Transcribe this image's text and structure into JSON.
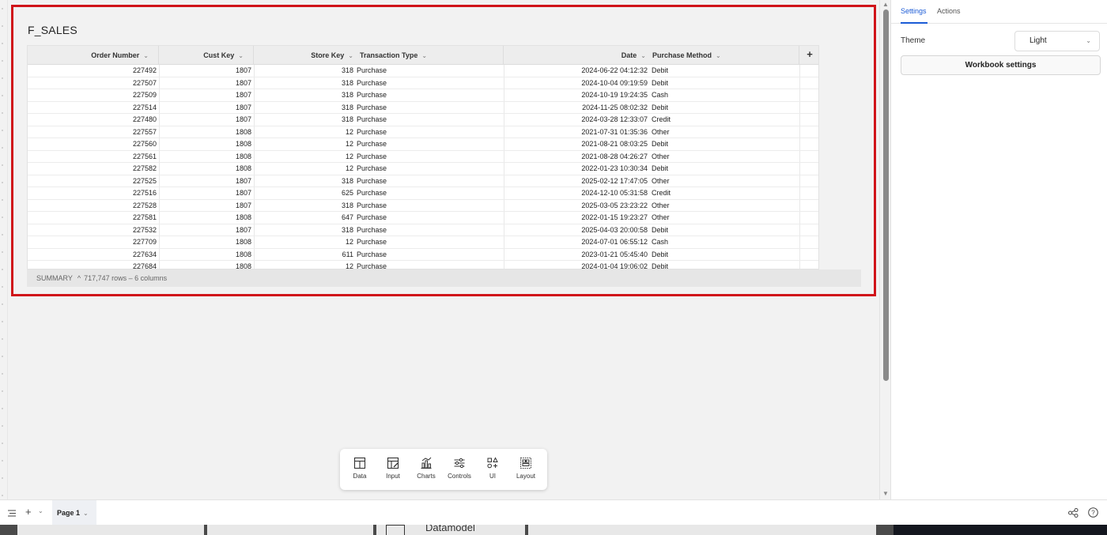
{
  "element": {
    "title": "F_SALES",
    "columns": [
      {
        "label": "Order Number",
        "chevron": "⌄"
      },
      {
        "label": "Cust Key",
        "chevron": "⌄"
      },
      {
        "label": "Store Key",
        "chevron": "⌄"
      },
      {
        "label": "Transaction Type",
        "chevron": "⌄"
      },
      {
        "label": "Date",
        "chevron": "⌄"
      },
      {
        "label": "Purchase Method",
        "chevron": "⌄"
      }
    ],
    "add_column": "+",
    "rows": [
      [
        "227492",
        "1807",
        "318",
        "Purchase",
        "2024-06-22 04:12:32",
        "Debit"
      ],
      [
        "227507",
        "1807",
        "318",
        "Purchase",
        "2024-10-04 09:19:59",
        "Debit"
      ],
      [
        "227509",
        "1807",
        "318",
        "Purchase",
        "2024-10-19 19:24:35",
        "Cash"
      ],
      [
        "227514",
        "1807",
        "318",
        "Purchase",
        "2024-11-25 08:02:32",
        "Debit"
      ],
      [
        "227480",
        "1807",
        "318",
        "Purchase",
        "2024-03-28 12:33:07",
        "Credit"
      ],
      [
        "227557",
        "1808",
        "12",
        "Purchase",
        "2021-07-31 01:35:36",
        "Other"
      ],
      [
        "227560",
        "1808",
        "12",
        "Purchase",
        "2021-08-21 08:03:25",
        "Debit"
      ],
      [
        "227561",
        "1808",
        "12",
        "Purchase",
        "2021-08-28 04:26:27",
        "Other"
      ],
      [
        "227582",
        "1808",
        "12",
        "Purchase",
        "2022-01-23 10:30:34",
        "Debit"
      ],
      [
        "227525",
        "1807",
        "318",
        "Purchase",
        "2025-02-12 17:47:05",
        "Other"
      ],
      [
        "227516",
        "1807",
        "625",
        "Purchase",
        "2024-12-10 05:31:58",
        "Credit"
      ],
      [
        "227528",
        "1807",
        "318",
        "Purchase",
        "2025-03-05 23:23:22",
        "Other"
      ],
      [
        "227581",
        "1808",
        "647",
        "Purchase",
        "2022-01-15 19:23:27",
        "Other"
      ],
      [
        "227532",
        "1807",
        "318",
        "Purchase",
        "2025-04-03 20:00:58",
        "Debit"
      ],
      [
        "227709",
        "1808",
        "12",
        "Purchase",
        "2024-07-01 06:55:12",
        "Cash"
      ],
      [
        "227634",
        "1808",
        "611",
        "Purchase",
        "2023-01-21 05:45:40",
        "Debit"
      ],
      [
        "227684",
        "1808",
        "12",
        "Purchase",
        "2024-01-04 19:06:02",
        "Debit"
      ]
    ],
    "summary": {
      "label": "SUMMARY",
      "caret": "^",
      "text": "717,747 rows – 6 columns"
    }
  },
  "panel": {
    "tabs": [
      {
        "label": "Settings",
        "active": true
      },
      {
        "label": "Actions",
        "active": false
      }
    ],
    "theme_label": "Theme",
    "theme_value": "Light",
    "workbook_settings": "Workbook settings"
  },
  "toolbar": {
    "items": [
      {
        "label": "Data",
        "icon": "table-icon"
      },
      {
        "label": "Input",
        "icon": "input-table-icon"
      },
      {
        "label": "Charts",
        "icon": "chart-icon"
      },
      {
        "label": "Controls",
        "icon": "sliders-icon"
      },
      {
        "label": "UI",
        "icon": "ui-shapes-icon"
      },
      {
        "label": "Layout",
        "icon": "layout-icon"
      }
    ]
  },
  "bottombar": {
    "page_tab": "Page 1"
  },
  "background_strip": {
    "label": "Datamodel"
  },
  "colors": {
    "accent": "#1b5bd6",
    "selection_border": "#d0141a"
  }
}
